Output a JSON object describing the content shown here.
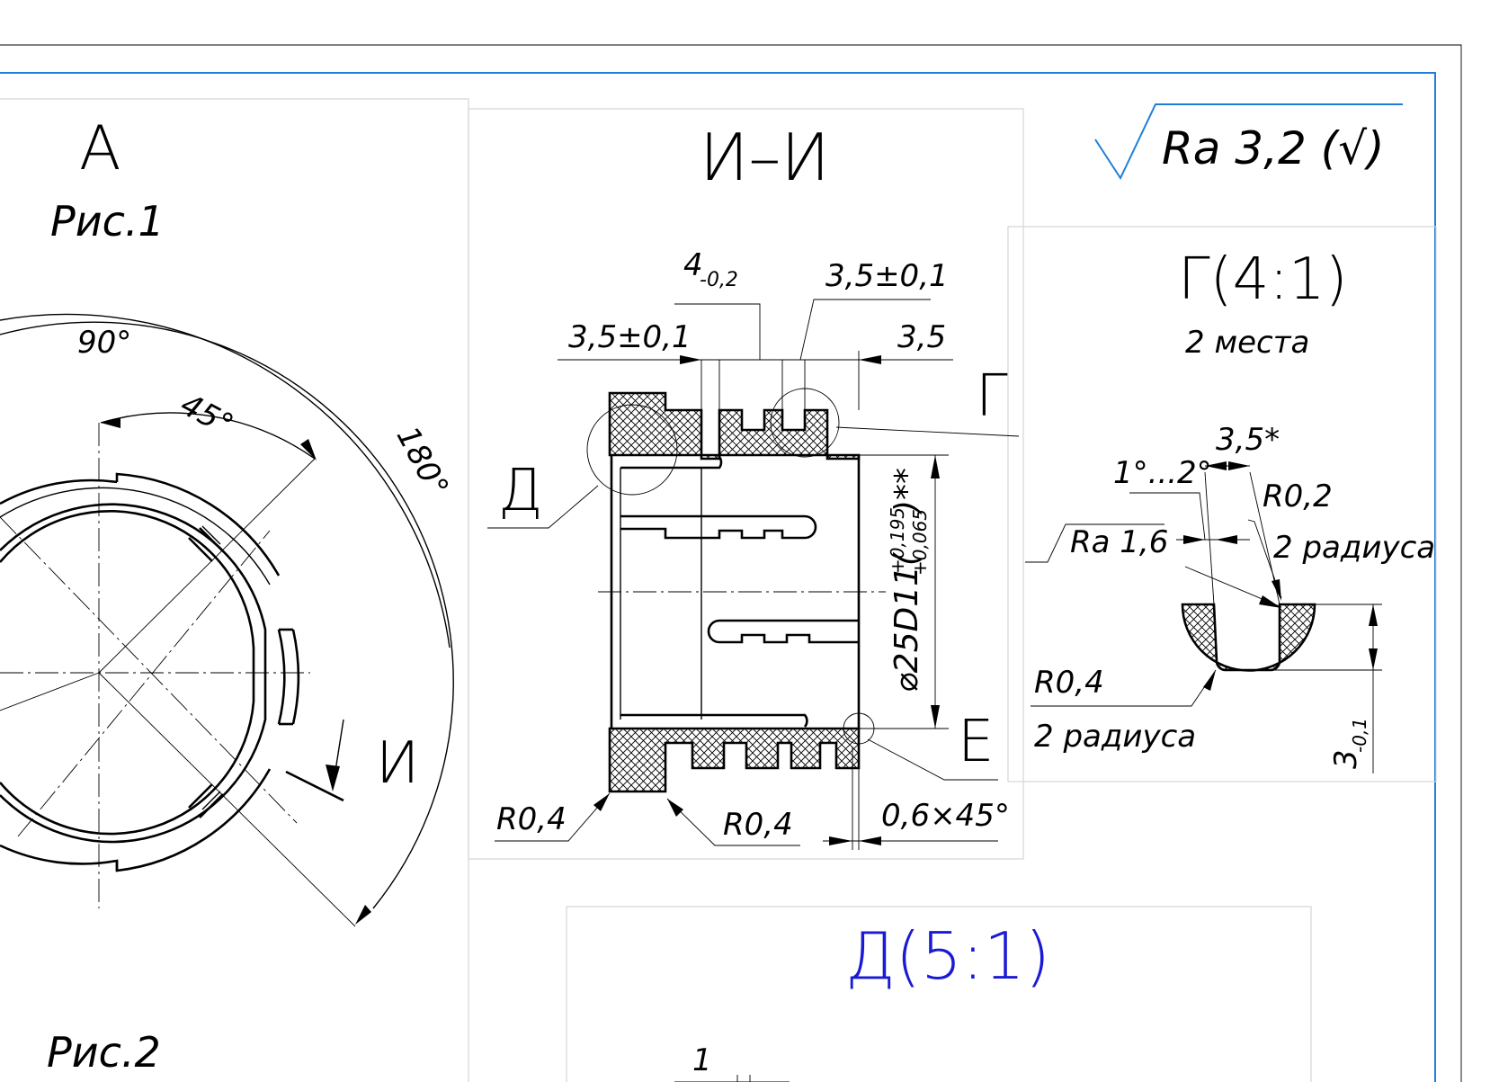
{
  "accent_color": "#1f7fd8",
  "title_color": "#1a1ad6",
  "view_a": {
    "title": "А",
    "fig1_label": "Рис.1",
    "fig2_label": "Рис.2",
    "angle_90": "90°",
    "angle_45": "45°",
    "angle_180": "180°",
    "section_mark": "И"
  },
  "section_ii": {
    "title": "И–И",
    "dim_4_main": "4",
    "dim_4_tol": "-0,2",
    "dim_35_tol_top": "3,5±0,1",
    "dim_35_tol_left": "3,5±0,1",
    "dim_35": "3,5",
    "label_g": "Г",
    "label_d": "Д",
    "label_e": "Е",
    "diameter_main": "⌀25D11(",
    "diameter_upper": "+0,195",
    "diameter_lower": "+0,065",
    "diameter_close": ")**",
    "radius_left": "R0,4",
    "radius_mid": "R0,4",
    "chamfer": "0,6×45°"
  },
  "roughness": {
    "general": "Ra 3,2 (√)"
  },
  "detail_g": {
    "title": "Г(4:1)",
    "subtitle": "2 места",
    "dim_35_star": "3,5*",
    "angle_range": "1°...2°",
    "radius_r02": "R0,2",
    "radius_r02_note": "2 радиуса",
    "roughness_16": "Ra 1,6",
    "radius_r04": "R0,4",
    "radius_r04_note": "2 радиуса",
    "dim_3_main": "3",
    "dim_3_tol": "-0,1"
  },
  "detail_d": {
    "title": "Д(5:1)",
    "dim_1": "1"
  }
}
